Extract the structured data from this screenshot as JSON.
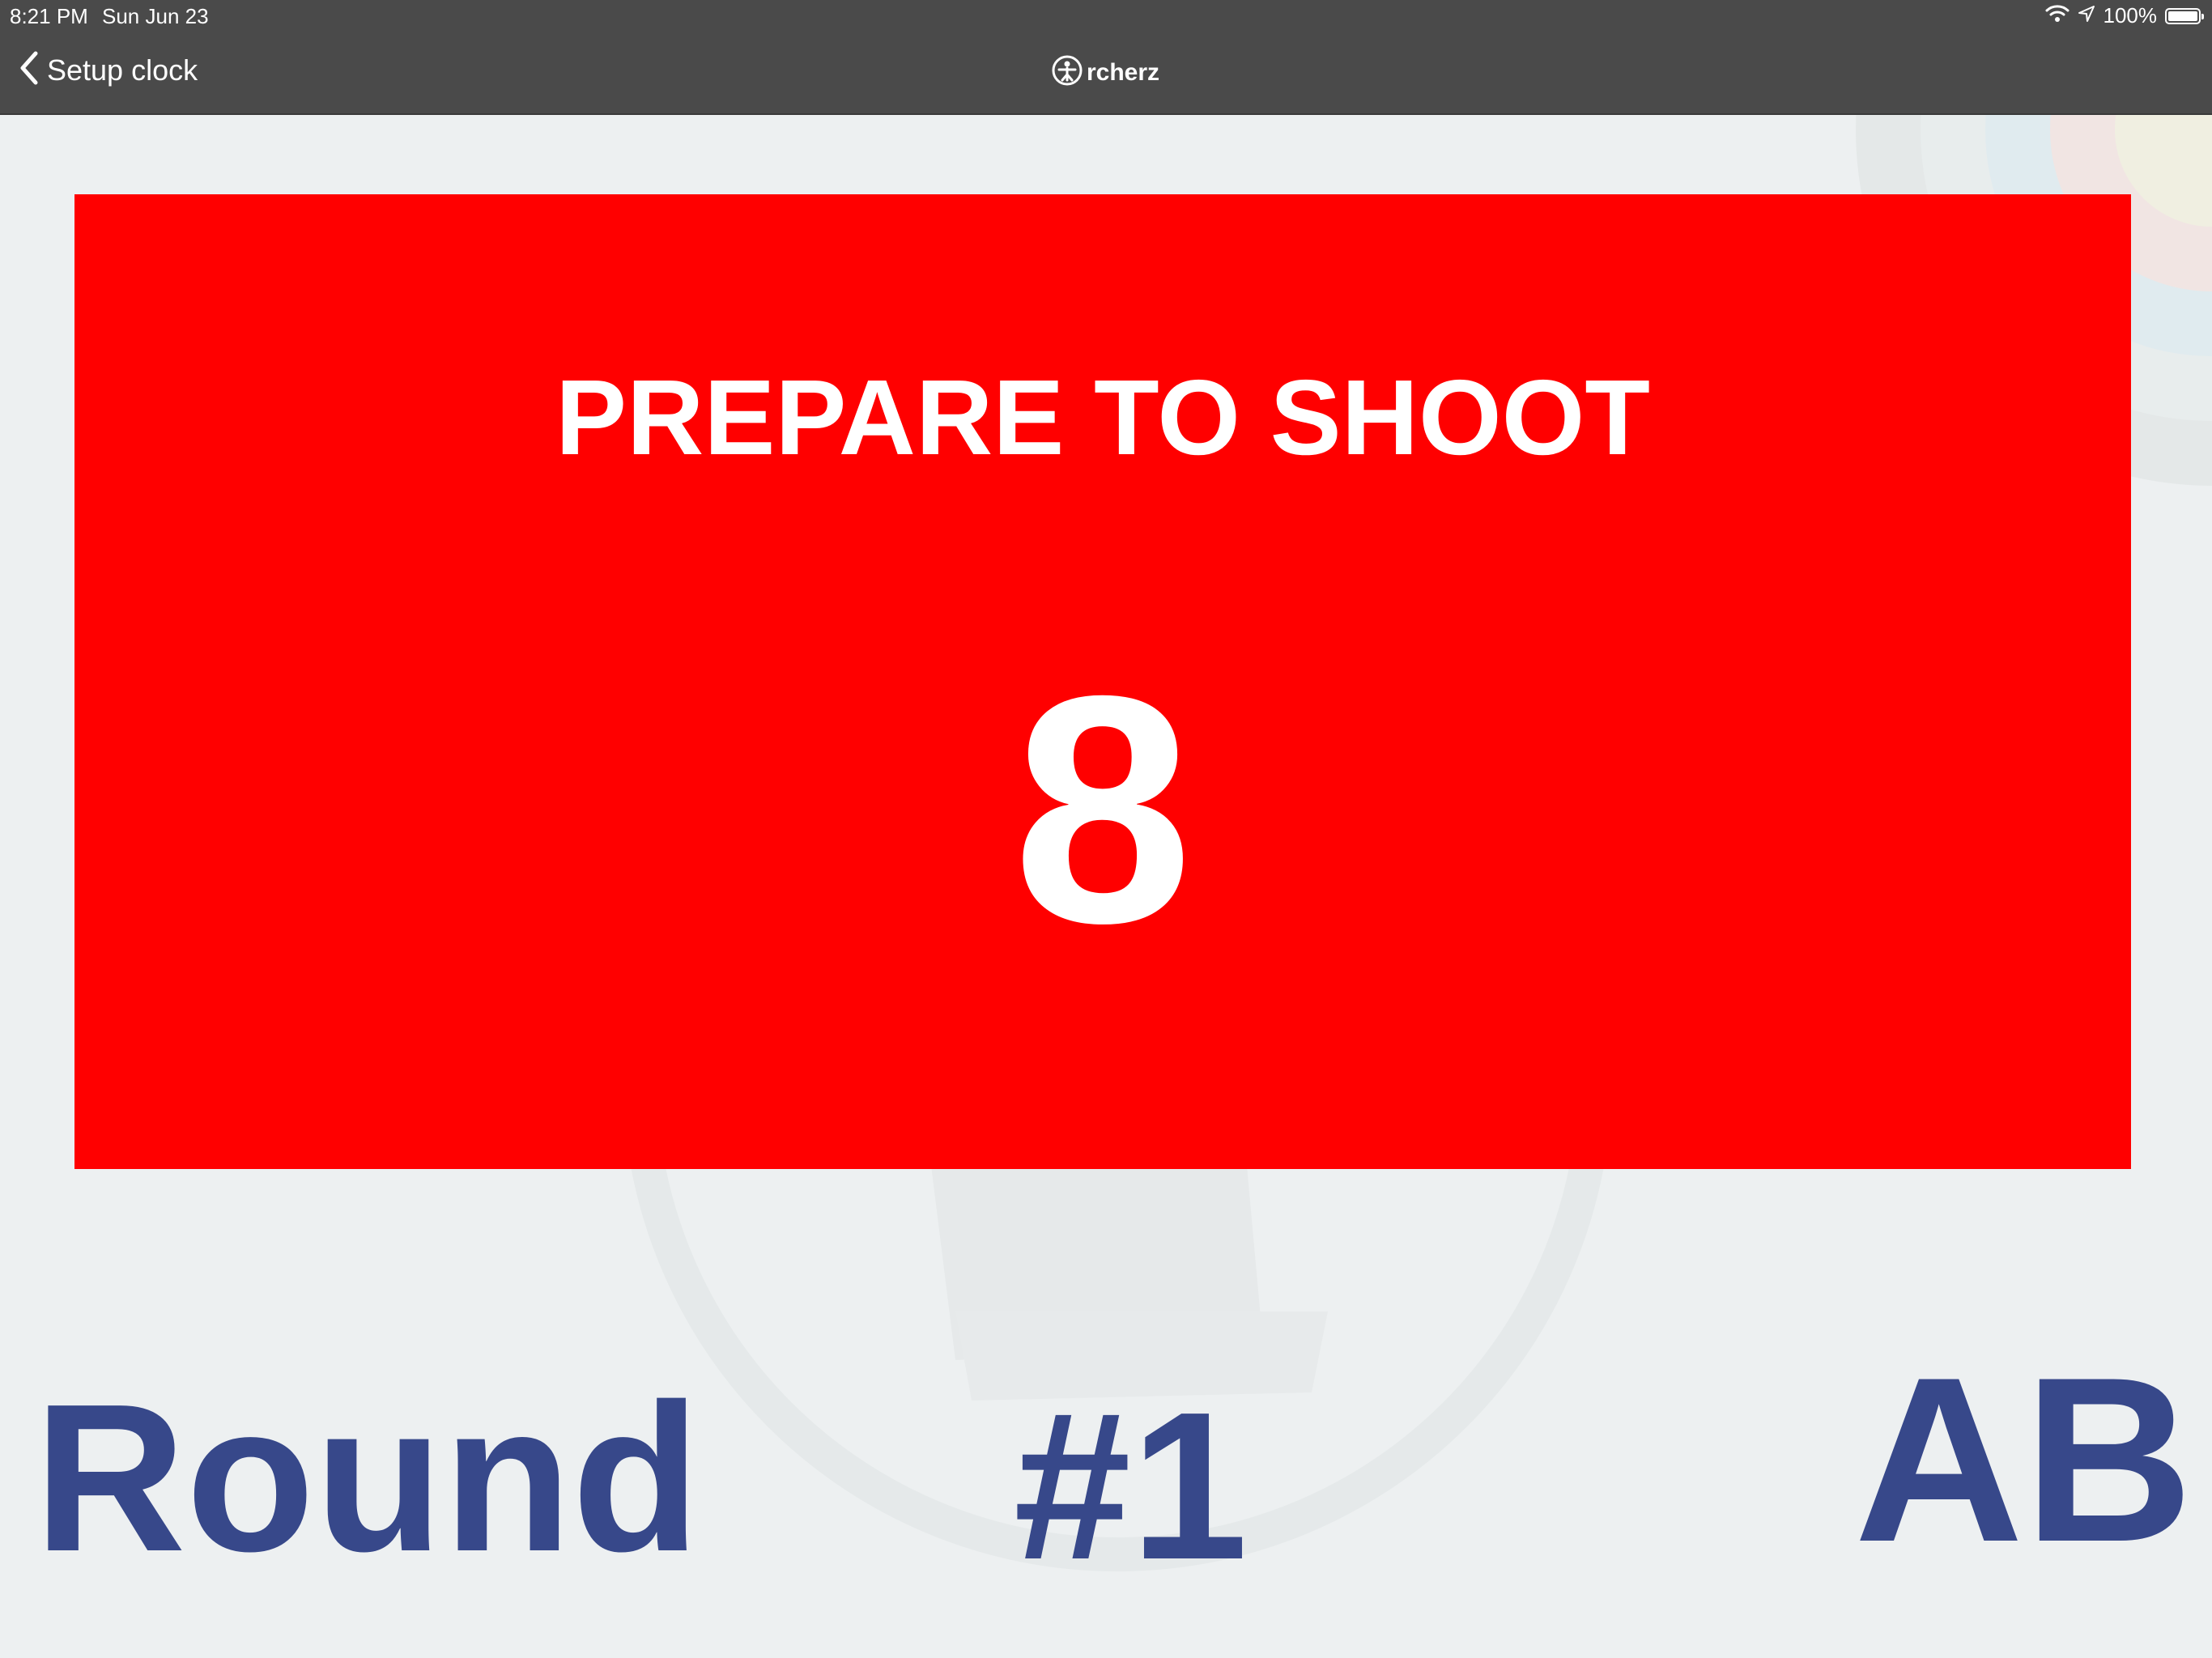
{
  "status_bar": {
    "time": "8:21 PM",
    "date": "Sun Jun 23",
    "battery": "100%",
    "wifi_icon": "wifi-icon",
    "location_icon": "location-arrow-icon",
    "battery_icon": "battery-icon"
  },
  "nav_bar": {
    "back_label": "Setup clock",
    "back_icon": "chevron-left-icon",
    "brand_logo_icon": "archer-logo-icon",
    "brand_name": "rcherz"
  },
  "clock": {
    "status": "PREPARE TO SHOOT",
    "countdown": "8",
    "background_color": "#ff0000"
  },
  "footer": {
    "round_label": "Round",
    "round_number": "#1",
    "group": "AB",
    "text_color": "#37488a"
  }
}
